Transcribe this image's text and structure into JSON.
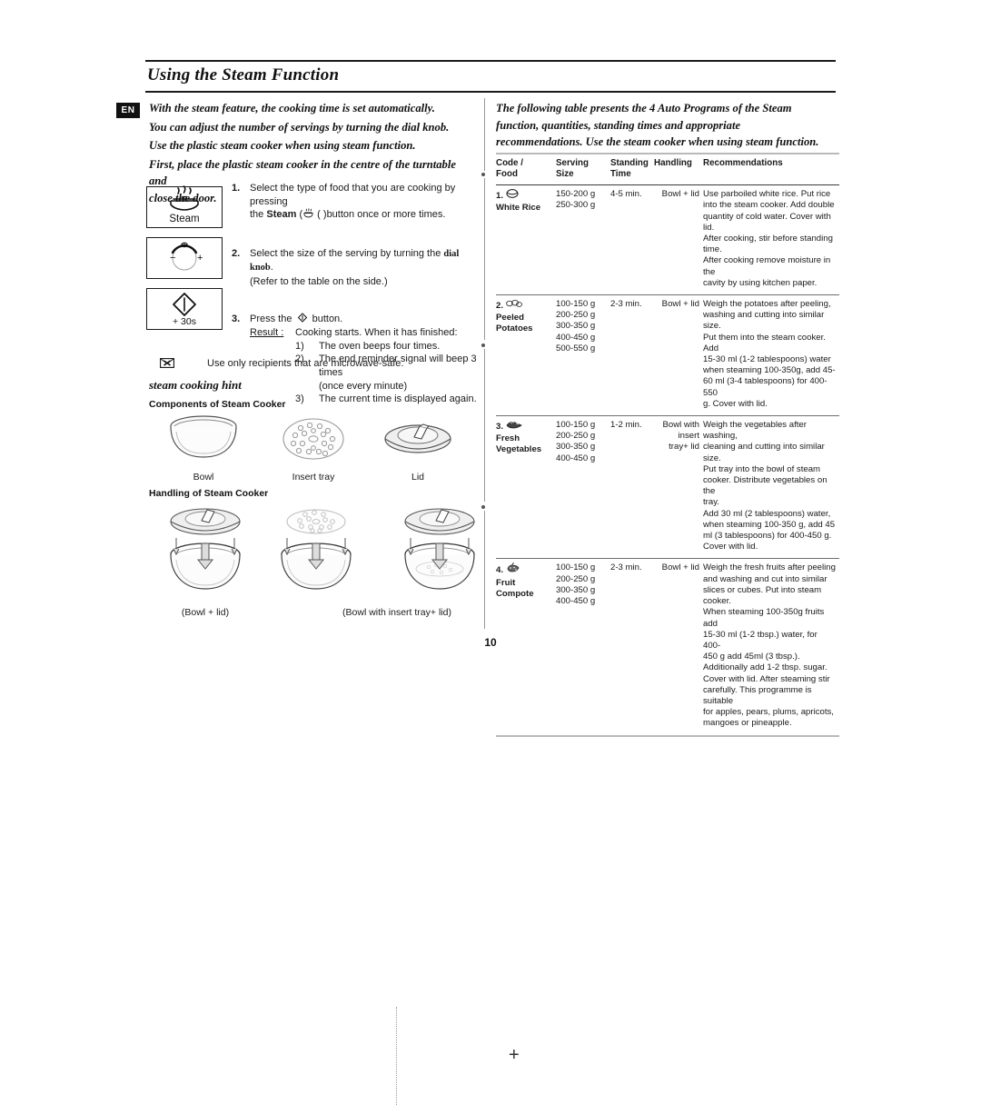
{
  "header": {
    "title": "Using the Steam Function"
  },
  "lang_badge": "EN",
  "page_number": "10",
  "left": {
    "intro": [
      "With the steam feature, the cooking time is set automatically.",
      "You can adjust the number of servings by turning the dial knob.",
      "Use the plastic steam cooker when using steam function.",
      "First, place the plastic steam cooker in the centre of the turntable and",
      "close the door."
    ],
    "keys": [
      {
        "name": "steam-button",
        "label": "Steam"
      },
      {
        "name": "dial-knob",
        "label": ""
      },
      {
        "name": "start-plus-30s-button",
        "label": "+ 30s"
      }
    ],
    "steps": [
      {
        "num": "1.",
        "text_a": "Select the type of food that you are cooking by pressing",
        "text_b_pre": "the ",
        "text_b_bold": "Steam",
        "text_b_post": " (      )button once or more times."
      },
      {
        "num": "2.",
        "text_a_pre": "Select the size of the serving by turning the ",
        "text_a_bold": "dial knob",
        "text_a_post": ".",
        "text_b": "(Refer to the table on the side.)"
      },
      {
        "num": "3.",
        "text_a_pre": "Press the",
        "text_a_post": "button.",
        "result_label": "Result :",
        "result_intro": "Cooking starts. When it has finished:",
        "result_items": [
          {
            "n": "1)",
            "t": "The oven beeps four times."
          },
          {
            "n": "2)",
            "t": "The end reminder signal will beep 3 times"
          },
          {
            "n": "",
            "t": "(once every minute)"
          },
          {
            "n": "3)",
            "t": "The current time is displayed again."
          }
        ]
      }
    ],
    "note": "Use only recipients that are microwave-safe.",
    "hint_title": "steam cooking hint",
    "components_heading": "Components of Steam Cooker",
    "components": [
      {
        "name": "bowl-illustration",
        "caption": "Bowl"
      },
      {
        "name": "insert-tray-illustration",
        "caption": "Insert tray"
      },
      {
        "name": "lid-illustration",
        "caption": "Lid"
      }
    ],
    "handling_heading": "Handling of Steam Cooker",
    "handling": [
      {
        "name": "bowl-plus-lid-illustration",
        "caption": "(Bowl + lid)"
      },
      {
        "name": "bowl-insert-tray-lid-illustration",
        "caption": "(Bowl with insert tray+ lid)"
      }
    ],
    "plus_sign": "+"
  },
  "right": {
    "intro": [
      "The following table presents the 4 Auto Programs of the Steam",
      "function, quantities, standing times and appropriate",
      "recommendations. Use the steam cooker when using steam function."
    ],
    "table": {
      "headers": [
        "Code /\nFood",
        "Serving\nSize",
        "Standing\nTime",
        "Handling",
        "Recommendations"
      ],
      "header_lines": {
        "code": [
          "Code /",
          "Food"
        ],
        "serving": [
          "Serving",
          "Size"
        ],
        "standing": [
          "Standing",
          "Time"
        ],
        "handling": [
          "Handling"
        ],
        "recommendations": [
          "Recommendations"
        ]
      },
      "rows": [
        {
          "code_num": "1.",
          "icon": "rice-bowl-icon",
          "food": "White Rice",
          "sizes": [
            "150-200 g",
            "250-300 g"
          ],
          "standing_time": "4-5 min.",
          "handling": [
            "Bowl + lid"
          ],
          "recommendations": [
            "Use parboiled white rice. Put rice",
            "into the steam cooker. Add double",
            "quantity of cold water. Cover with lid.",
            "After cooking, stir before standing",
            "time.",
            "After cooking remove moisture in the",
            "cavity by using kitchen paper."
          ]
        },
        {
          "code_num": "2.",
          "icon": "potatoes-icon",
          "food": "Peeled\nPotatoes",
          "food_lines": [
            "Peeled",
            "Potatoes"
          ],
          "sizes": [
            "100-150 g",
            "200-250 g",
            "300-350 g",
            "400-450 g",
            "500-550 g"
          ],
          "standing_time": "2-3 min.",
          "handling": [
            "Bowl + lid"
          ],
          "recommendations": [
            "Weigh the potatoes after peeling,",
            "washing and cutting into similar size.",
            "Put them into the steam cooker. Add",
            "15-30 ml (1-2 tablespoons) water",
            "when steaming 100-350g, add 45-",
            "60 ml (3-4 tablespoons) for 400-550",
            "g. Cover with lid."
          ]
        },
        {
          "code_num": "3.",
          "icon": "vegetables-icon",
          "food": "Fresh\nVegetables",
          "food_lines": [
            "Fresh",
            "Vegetables"
          ],
          "sizes": [
            "100-150 g",
            "200-250 g",
            "300-350 g",
            "400-450 g"
          ],
          "standing_time": "1-2 min.",
          "handling": [
            "Bowl with",
            "insert",
            "tray+ lid"
          ],
          "recommendations": [
            "Weigh the vegetables after washing,",
            "cleaning and cutting into similar size.",
            "Put tray into the bowl of steam",
            "cooker. Distribute vegetables on the",
            "tray.",
            "Add 30 ml (2 tablespoons) water,",
            "when steaming 100-350 g, add 45",
            "ml (3 tablespoons) for 400-450 g.",
            "Cover with lid."
          ]
        },
        {
          "code_num": "4.",
          "icon": "fruit-icon",
          "food": "Fruit\nCompote",
          "food_lines": [
            "Fruit",
            "Compote"
          ],
          "sizes": [
            "100-150 g",
            "200-250 g",
            "300-350 g",
            "400-450 g"
          ],
          "standing_time": "2-3 min.",
          "handling": [
            "Bowl + lid"
          ],
          "recommendations": [
            "Weigh the fresh fruits after peeling",
            "and washing and cut into similar",
            "slices or cubes. Put into steam",
            "cooker.",
            "When steaming 100-350g fruits add",
            "15-30 ml (1-2 tbsp.) water, for 400-",
            "450 g add 45ml (3 tbsp.).",
            "Additionally add 1-2 tbsp. sugar.",
            "Cover with lid. After steaming stir",
            "carefully. This programme is suitable",
            "for apples, pears, plums, apricots,",
            "mangoes or pineapple."
          ]
        }
      ]
    }
  }
}
